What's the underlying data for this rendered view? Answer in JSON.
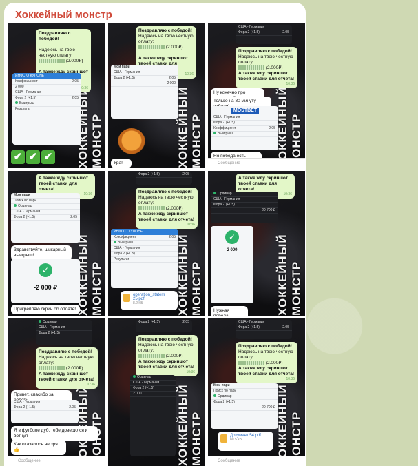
{
  "channel": {
    "title": "Хоккейный монстр"
  },
  "watermark": "ХОККЕЙНЫЙ МОНСТР",
  "messages": {
    "congrats": "Поздравляю с победой!",
    "hope_pay": "Надеюсь на твою честную оплату:",
    "amount": "(2.000₽)",
    "await": "А также жду скриншот твоей ставки для отчета!",
    "serious": "Ну конечно про серьезный",
    "eighty": "Только на 80 минуту забили)",
    "but_win": "Но победа есть победа 😏",
    "ura": "Ура!",
    "hello_win": "Здравствуйте, шикарный выигрыш!",
    "attach": "Прикрепляю скрин об оплате!",
    "need_win": "Нужная победа!",
    "thanks": "Привет, спасибо за работу",
    "football": "Я в футболе дуб, тебе доверился и вотнул",
    "turned_out": "Как оказалось не зря 👍",
    "input_placeholder": "Сообщение"
  },
  "times": {
    "t1": "10:36",
    "t2": "11:02",
    "t3": "11:11",
    "t4": "13:24",
    "t5": "13:45"
  },
  "bet": {
    "coupon_head": "ИНФО О КУПОНЕ",
    "match": "США - Германия",
    "market": "Фора 2 (+1.5)",
    "odds": "2.05",
    "stake": "2 000",
    "koef_label": "Коэффициент",
    "result_label": "Результат",
    "won": "Выигрыш",
    "my_bets": "Мои пари",
    "single": "Ординар",
    "plus_win": "+ 20 700 ₽",
    "minus_amount": "-2 000 ₽",
    "search": "Поиск по пари",
    "brand": "MOSTBET"
  },
  "files": {
    "f1_name": "operation_statem 25.pdf",
    "f1_size": "8.2 КБ",
    "f2_name": "Документ 54.pdf",
    "f2_size": "80.5 КБ"
  },
  "checks": [
    "✔",
    "✔",
    "✔"
  ]
}
